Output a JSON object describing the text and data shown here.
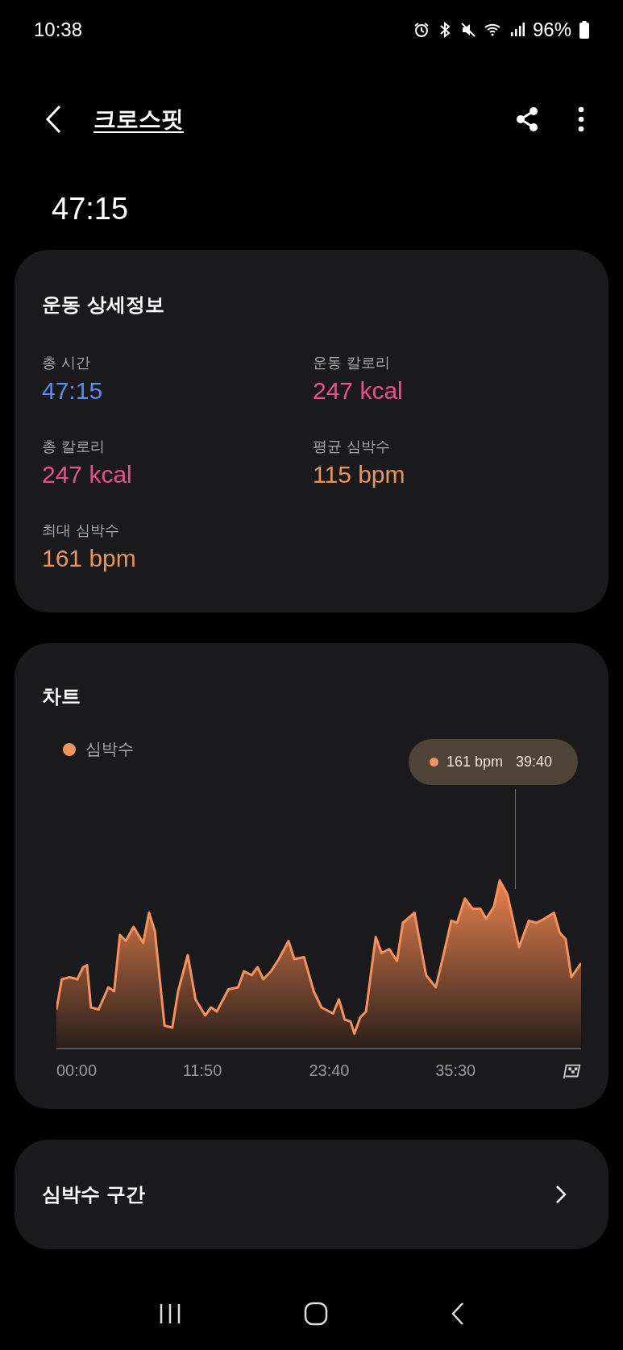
{
  "status_bar": {
    "time": "10:38",
    "battery": "96%"
  },
  "header": {
    "title": "크로스핏"
  },
  "duration": "47:15",
  "details": {
    "title": "운동 상세정보",
    "metrics": [
      {
        "label": "총 시간",
        "value": "47:15",
        "color": "#5b8def"
      },
      {
        "label": "운동 칼로리",
        "value": "247 kcal",
        "color": "#e6508c"
      },
      {
        "label": "총 칼로리",
        "value": "247 kcal",
        "color": "#e6508c"
      },
      {
        "label": "평균 심박수",
        "value": "115 bpm",
        "color": "#e8945a"
      },
      {
        "label": "최대 심박수",
        "value": "161 bpm",
        "color": "#e8945a"
      }
    ]
  },
  "chart": {
    "title": "차트",
    "legend": {
      "label": "심박수",
      "color": "#f0945f"
    },
    "tooltip": {
      "value": "161 bpm",
      "time": "39:40"
    },
    "x_labels": [
      "00:00",
      "11:50",
      "23:40",
      "35:30"
    ]
  },
  "section": {
    "title": "심박수 구간"
  }
}
